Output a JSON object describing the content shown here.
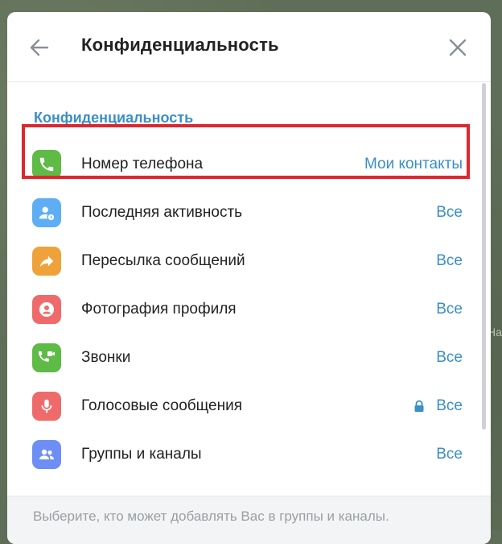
{
  "dialog": {
    "title": "Конфиденциальность",
    "section_title": "Конфиденциальность",
    "back_icon": "arrow-left-icon",
    "close_icon": "close-icon"
  },
  "items": [
    {
      "label": "Номер телефона",
      "value": "Мои контакты",
      "icon": "phone-icon",
      "color": "#5dbb46",
      "highlighted": true
    },
    {
      "label": "Последняя активность",
      "value": "Все",
      "icon": "user-clock-icon",
      "color": "#5eaef5"
    },
    {
      "label": "Пересылка сообщений",
      "value": "Все",
      "icon": "forward-arrow-icon",
      "color": "#f0a23a"
    },
    {
      "label": "Фотография профиля",
      "value": "Все",
      "icon": "profile-photo-icon",
      "color": "#ef6b6b"
    },
    {
      "label": "Звонки",
      "value": "Все",
      "icon": "video-call-icon",
      "color": "#5dbb46"
    },
    {
      "label": "Голосовые сообщения",
      "value": "Все",
      "icon": "microphone-icon",
      "color": "#ef6b6b",
      "locked": true
    },
    {
      "label": "Группы и каналы",
      "value": "Все",
      "icon": "group-icon",
      "color": "#6d8ff5"
    }
  ],
  "footer": {
    "hint": "Выберите, кто может добавлять Вас в группы и каналы."
  },
  "background": {
    "partial_text": "На"
  }
}
